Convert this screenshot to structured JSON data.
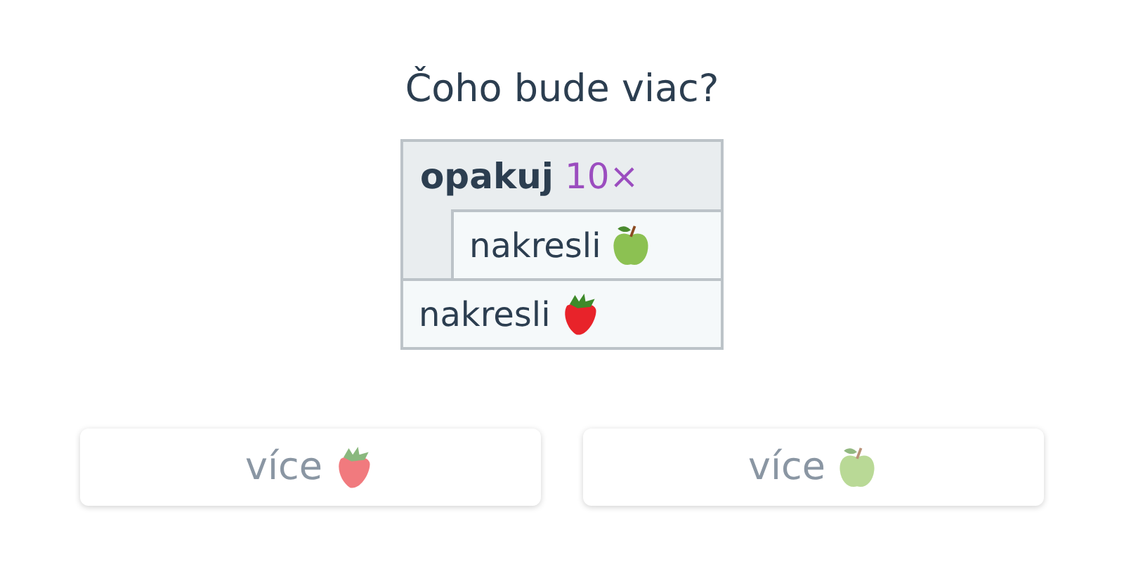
{
  "question": "Čoho bude viac?",
  "program": [
    {
      "kind": "repeat",
      "keyword": "opakuj",
      "count": "10×",
      "children": [
        {
          "kind": "draw",
          "label": "nakresli",
          "icon": {
            "kind": "apple"
          }
        }
      ]
    },
    {
      "kind": "draw",
      "label": "nakresli",
      "icon": {
        "kind": "strawberry"
      }
    }
  ],
  "answers": [
    {
      "label": "více",
      "icon": {
        "kind": "strawberry"
      },
      "disabled": true
    },
    {
      "label": "více",
      "icon": {
        "kind": "apple"
      },
      "disabled": true
    }
  ]
}
